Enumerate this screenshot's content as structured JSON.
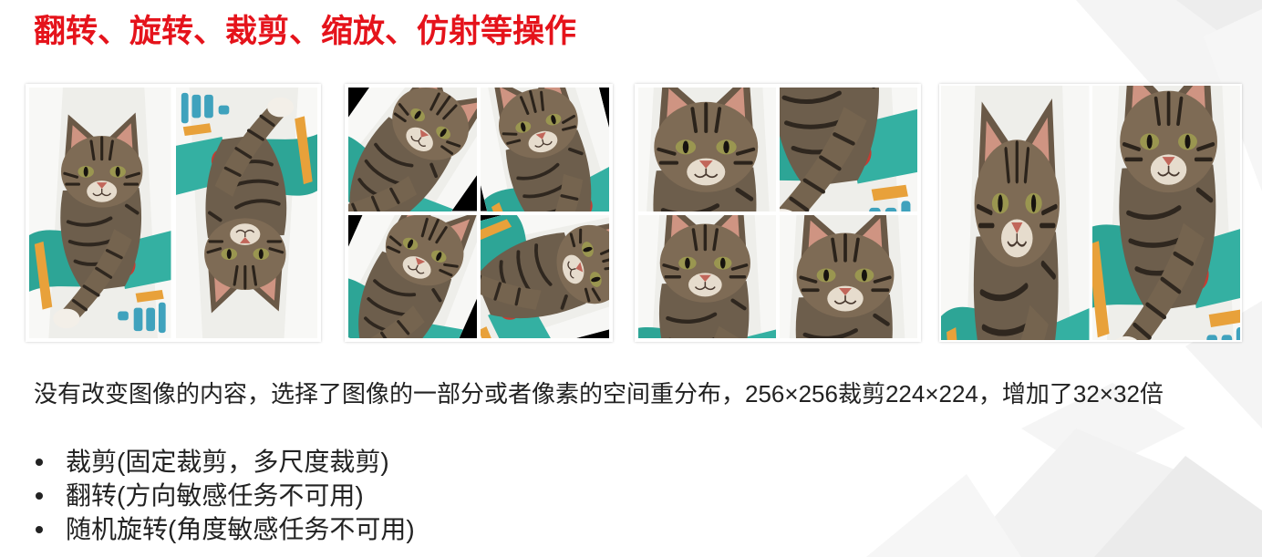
{
  "slide": {
    "title": "翻转、旋转、裁剪、缩放、仿射等操作",
    "description": "没有改变图像的内容，选择了图像的一部分或者像素的空间重分布，256×256裁剪224×224，增加了32×32倍",
    "bullets": [
      "裁剪(固定裁剪，多尺度裁剪)",
      "翻转(方向敏感任务不可用)",
      "随机旋转(角度敏感任务不可用)"
    ]
  },
  "colors": {
    "title": "#e5131b",
    "text": "#222222",
    "background": "#ffffff",
    "image_frame": "#ffffff"
  },
  "icons": {
    "bullet": "bullet-dot-icon"
  }
}
